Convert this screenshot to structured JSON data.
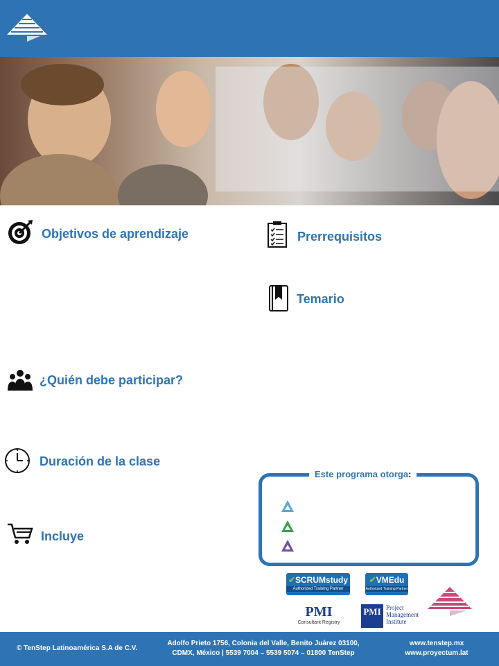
{
  "sections": {
    "objetivos": "Objetivos de aprendizaje",
    "prerrequisitos": "Prerrequisitos",
    "temario": "Temario",
    "quien": "¿Quién debe participar?",
    "duracion": "Duración de la clase",
    "incluye": "Incluye"
  },
  "certificates": {
    "title": "Este programa otorga",
    "colon": ":"
  },
  "partners": {
    "scrum_brand": "SCRUMstudy",
    "scrum_sub": "Authorized Training Partner",
    "vmedu_brand": "VMEdu",
    "vmedu_sub": "Authorized Training Partner",
    "pmi": "PMI",
    "pmi_sub": "Consultant Registry",
    "pmi_line1": "Project",
    "pmi_line2": "Management",
    "pmi_line3": "Institute"
  },
  "footer": {
    "copyright": "© TenStep Latinoamérica S.A de C.V.",
    "address1": "Adolfo Prieto 1756, Colonia  del Valle, Benito Juárez 03100,",
    "address2": "CDMX,  México | 5539 7004 – 5539 5074 – 01800 TenStep",
    "web1": "www.tenstep.mx",
    "web2": "www.proyectum.lat"
  },
  "colors": {
    "brand_blue": "#2e74b5",
    "bullet_blue": "#5aa9d6",
    "bullet_green": "#3aa14a",
    "bullet_purple": "#6b4fa8"
  }
}
